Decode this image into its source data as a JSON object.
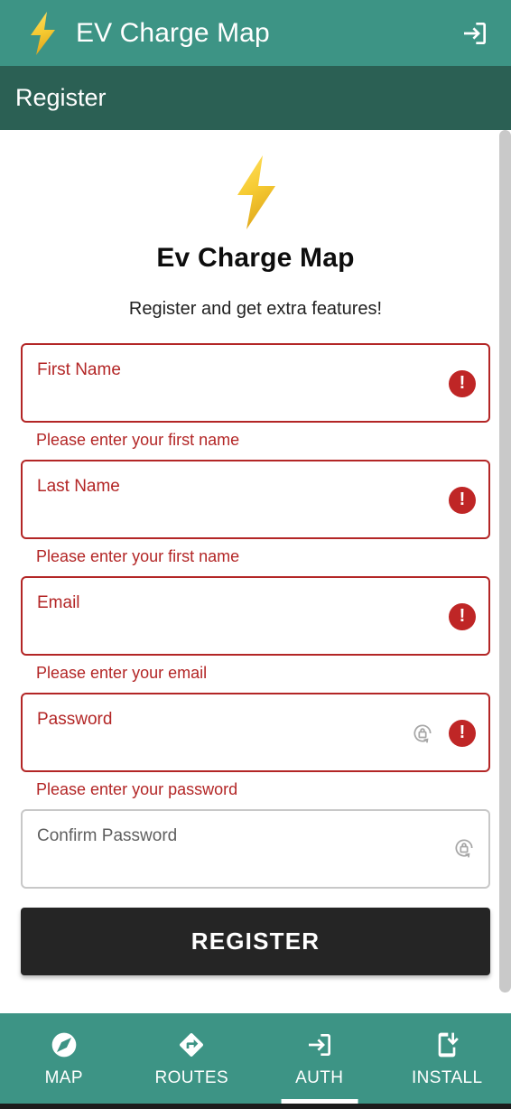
{
  "appbar": {
    "logo_icon": "lightning-bolt-icon",
    "title": "EV Charge Map",
    "login_icon": "login-icon"
  },
  "subheader": {
    "title": "Register"
  },
  "brand": {
    "logo_icon": "lightning-bolt-icon",
    "title": "Ev Charge Map",
    "subtitle": "Register and get extra features!"
  },
  "form": {
    "fields": [
      {
        "name": "first-name",
        "label": "First Name",
        "value": "",
        "error": true,
        "error_message": "Please enter your first name",
        "has_password_icon": false
      },
      {
        "name": "last-name",
        "label": "Last Name",
        "value": "",
        "error": true,
        "error_message": "Please enter your first name",
        "has_password_icon": false
      },
      {
        "name": "email",
        "label": "Email",
        "value": "",
        "error": true,
        "error_message": "Please enter your email",
        "has_password_icon": false
      },
      {
        "name": "password",
        "label": "Password",
        "value": "",
        "error": true,
        "error_message": "Please enter your password",
        "has_password_icon": true
      },
      {
        "name": "confirm-password",
        "label": "Confirm Password",
        "value": "",
        "error": false,
        "error_message": "",
        "has_password_icon": true
      }
    ],
    "submit_label": "REGISTER"
  },
  "bottom_nav": {
    "items": [
      {
        "name": "map",
        "label": "MAP",
        "icon": "explore-compass-icon",
        "active": false
      },
      {
        "name": "routes",
        "label": "ROUTES",
        "icon": "directions-icon",
        "active": false
      },
      {
        "name": "auth",
        "label": "AUTH",
        "icon": "login-icon",
        "active": true
      },
      {
        "name": "install",
        "label": "INSTALL",
        "icon": "phone-download-icon",
        "active": false
      }
    ]
  },
  "colors": {
    "appbar_green": "#3d9485",
    "subheader_green": "#2b6054",
    "error_red": "#b32626",
    "error_icon_red": "#bf2626",
    "button_dark": "#252525",
    "bolt_yellow": "#f3c73a",
    "scrollbar_grey": "#c9c9c9"
  },
  "scrollbar": {
    "name": "vertical-scrollbar"
  }
}
